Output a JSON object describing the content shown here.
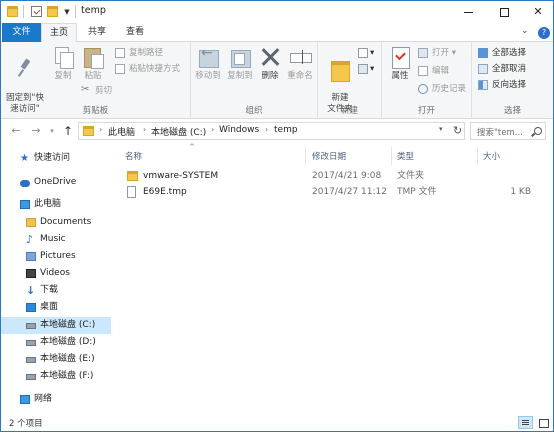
{
  "window": {
    "title": "temp"
  },
  "tabs": {
    "file": "文件",
    "home": "主页",
    "share": "共享",
    "view": "查看"
  },
  "ribbon": {
    "clipboard": {
      "label": "剪贴板",
      "pin": "固定到\"快\n速访问\"",
      "copy": "复制",
      "paste": "粘贴",
      "copy_path": "复制路径",
      "paste_shortcut": "粘贴快捷方式",
      "cut": "剪切"
    },
    "organize": {
      "label": "组织",
      "move_to": "移动到",
      "copy_to": "复制到",
      "delete": "删除",
      "rename": "重命名"
    },
    "new": {
      "label": "新建",
      "new_folder": "新建\n文件夹"
    },
    "open": {
      "label": "打开",
      "properties": "属性",
      "open": "打开",
      "edit": "编辑",
      "history": "历史记录"
    },
    "select": {
      "label": "选择",
      "select_all": "全部选择",
      "select_none": "全部取消",
      "invert": "反向选择"
    }
  },
  "address": {
    "crumbs": [
      "此电脑",
      "本地磁盘 (C:)",
      "Windows",
      "temp"
    ],
    "search_placeholder": "搜索\"tem..."
  },
  "navpane": {
    "quick_access": "快速访问",
    "onedrive": "OneDrive",
    "this_pc": "此电脑",
    "documents": "Documents",
    "music": "Music",
    "pictures": "Pictures",
    "videos": "Videos",
    "downloads": "下载",
    "desktop": "桌面",
    "drive_c": "本地磁盘 (C:)",
    "drive_d": "本地磁盘 (D:)",
    "drive_e": "本地磁盘 (E:)",
    "drive_f": "本地磁盘 (F:)",
    "network": "网络"
  },
  "filelist": {
    "columns": {
      "name": "名称",
      "date": "修改日期",
      "type": "类型",
      "size": "大小"
    },
    "rows": [
      {
        "name": "vmware-SYSTEM",
        "date": "2017/4/21 9:08",
        "type": "文件夹",
        "size": "",
        "icon": "folder-icon"
      },
      {
        "name": "E69E.tmp",
        "date": "2017/4/27 11:12",
        "type": "TMP 文件",
        "size": "1 KB",
        "icon": "file-icon"
      }
    ]
  },
  "status": {
    "count": "2 个项目"
  },
  "colors": {
    "accent": "#1979ca",
    "selected": "#cce8ff"
  }
}
